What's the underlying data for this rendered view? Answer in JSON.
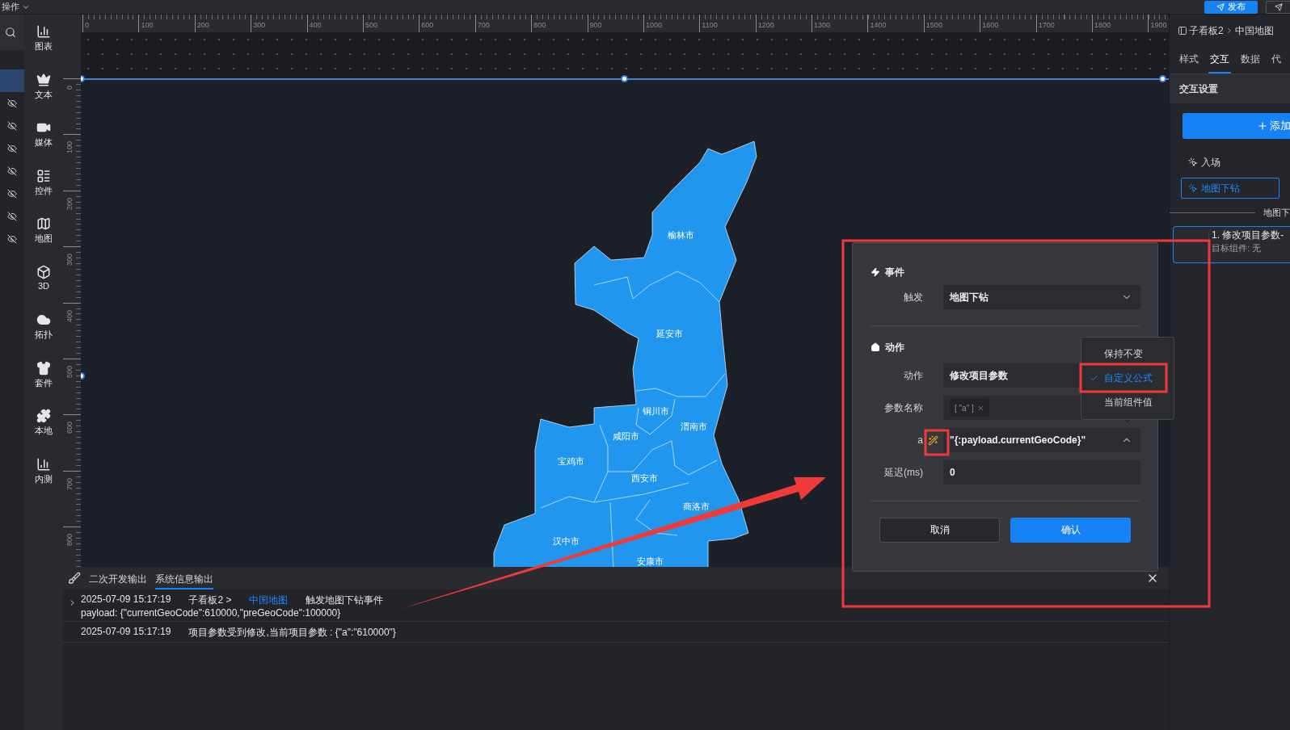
{
  "top_bar": {
    "menu": "操作",
    "publish_button": "发布"
  },
  "layers": [
    {
      "selected": true,
      "hidden": false
    },
    {
      "selected": false,
      "hidden": true
    },
    {
      "selected": false,
      "hidden": true
    },
    {
      "selected": false,
      "hidden": true
    },
    {
      "selected": false,
      "hidden": true
    },
    {
      "selected": false,
      "hidden": true
    },
    {
      "selected": false,
      "hidden": true
    },
    {
      "selected": false,
      "hidden": true
    }
  ],
  "component_bar": [
    {
      "label": "图表",
      "kind": "chart"
    },
    {
      "label": "文本",
      "kind": "text"
    },
    {
      "label": "媒体",
      "kind": "media"
    },
    {
      "label": "控件",
      "kind": "control"
    },
    {
      "label": "地图",
      "kind": "map"
    },
    {
      "label": "3D",
      "kind": "cube"
    },
    {
      "label": "拓扑",
      "kind": "topology"
    },
    {
      "label": "套件",
      "kind": "suite"
    },
    {
      "label": "本地",
      "kind": "local"
    },
    {
      "label": "内测",
      "kind": "chart"
    }
  ],
  "ruler": {
    "x_ticks": [
      "0",
      "100",
      "200",
      "300",
      "400",
      "500",
      "600",
      "700",
      "800",
      "900",
      "1000",
      "1100",
      "1200",
      "1300",
      "1400",
      "1500",
      "1600",
      "1700",
      "1800",
      "1900"
    ],
    "y_ticks": [
      "0",
      "100",
      "200",
      "300",
      "400",
      "500",
      "600",
      "700",
      "800"
    ]
  },
  "map": {
    "regions": [
      {
        "name": "榆林市"
      },
      {
        "name": "延安市"
      },
      {
        "name": "铜川市"
      },
      {
        "name": "渭南市"
      },
      {
        "name": "咸阳市"
      },
      {
        "name": "宝鸡市"
      },
      {
        "name": "西安市"
      },
      {
        "name": "商洛市"
      },
      {
        "name": "汉中市"
      },
      {
        "name": "安康市"
      }
    ]
  },
  "console": {
    "tabs": [
      {
        "label": "二次开发输出",
        "selected": false
      },
      {
        "label": "系统信息输出",
        "selected": true
      }
    ],
    "logs": [
      {
        "time": "2025-07-09 15:17:19",
        "expandable": true,
        "parts": [
          {
            "text": "子看板2 >",
            "kind": "text"
          },
          {
            "text": "中国地图",
            "kind": "link"
          },
          {
            "text": "触发地图下钻事件",
            "kind": "text"
          }
        ],
        "detail": "payload: {\"currentGeoCode\":610000,\"preGeoCode\":100000}"
      },
      {
        "time": "2025-07-09 15:17:19",
        "expandable": false,
        "parts": [
          {
            "text": "项目参数受到修改,当前项目参数 : {\"a\":\"610000\"}",
            "kind": "text"
          }
        ]
      }
    ]
  },
  "dialog": {
    "event_section": "事件",
    "trigger": {
      "label": "触发",
      "value": "地图下钻"
    },
    "action_section": "动作",
    "action": {
      "label": "动作",
      "value": "修改项目参数"
    },
    "param_name": {
      "label": "参数名称",
      "tags": [
        "[ \"a\" ]"
      ]
    },
    "param_value": {
      "label": "a",
      "value": "\"{:payload.currentGeoCode}\"",
      "expanded": true
    },
    "delay": {
      "label": "延迟(ms)",
      "value": "0"
    },
    "buttons": [
      {
        "label": "取消",
        "kind": "secondary"
      },
      {
        "label": "确认",
        "kind": "primary"
      }
    ],
    "menu": [
      {
        "label": "保持不变",
        "selected": false
      },
      {
        "label": "自定义公式",
        "selected": true
      },
      {
        "label": "当前组件值",
        "selected": false
      }
    ]
  },
  "right_panel": {
    "breadcrumb": [
      "子看板2",
      "中国地图"
    ],
    "tabs": [
      {
        "label": "样式",
        "selected": false
      },
      {
        "label": "交互",
        "selected": true
      },
      {
        "label": "数据",
        "selected": false
      },
      {
        "label": "代",
        "selected": false
      }
    ],
    "section": "交互设置",
    "add_button": "添加",
    "events": [
      {
        "label": "入场",
        "selected": false
      },
      {
        "label": "地图下钻",
        "selected": true
      }
    ],
    "divider_label": "地图下",
    "action_card": {
      "title": "1. 修改项目参数-",
      "subtitle": "目标组件: 无"
    }
  }
}
